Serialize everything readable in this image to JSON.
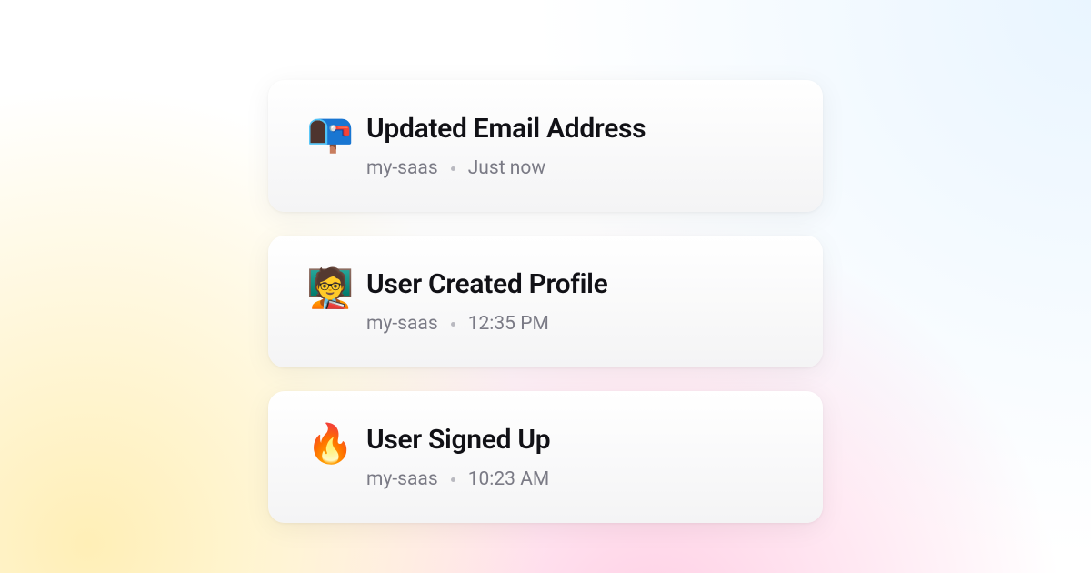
{
  "events": [
    {
      "icon": "📭",
      "icon_name": "mailbox-icon",
      "title": "Updated Email Address",
      "project": "my-saas",
      "time": "Just now"
    },
    {
      "icon": "🧑‍🏫",
      "icon_name": "teacher-icon",
      "title": "User Created Profile",
      "project": "my-saas",
      "time": "12:35 PM"
    },
    {
      "icon": "🔥",
      "icon_name": "fire-icon",
      "title": "User Signed Up",
      "project": "my-saas",
      "time": "10:23 AM"
    }
  ]
}
